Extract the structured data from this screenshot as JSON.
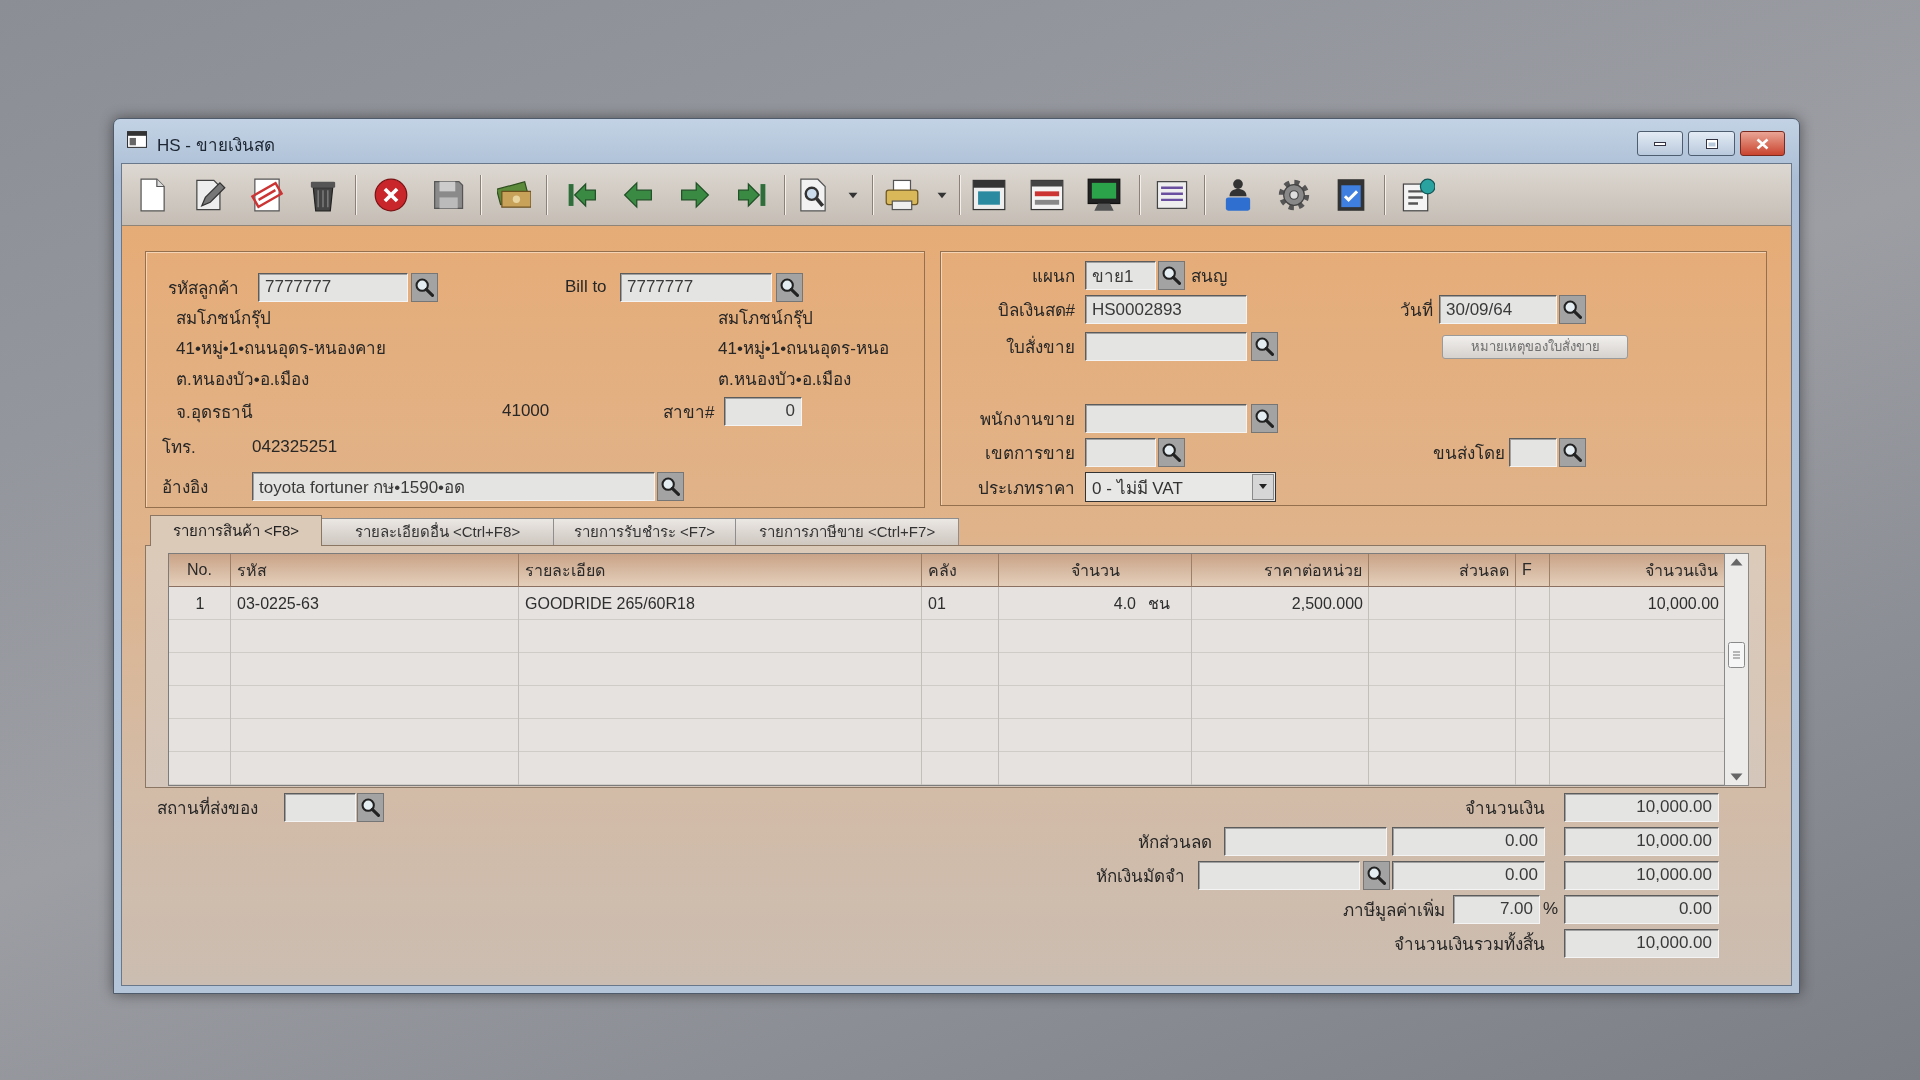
{
  "window": {
    "title": "HS - ขายเงินสด"
  },
  "customer": {
    "code_label": "รหัสลูกค้า",
    "code": "7777777",
    "name": "สมโภชน์กรุ๊ป",
    "address_lines": [
      "41•หมู่•1•ถนนอุดร-หนองคาย",
      "ต.หนองบัว•อ.เมือง",
      "จ.อุดรธานี"
    ],
    "postcode": "41000",
    "phone_label": "โทร.",
    "phone": "042325251",
    "reference_label": "อ้างอิง",
    "reference": "toyota fortuner กษ•1590•อด"
  },
  "bill_to": {
    "label": "Bill to",
    "code": "7777777",
    "name": "สมโภชน์กรุ๊ป",
    "address_lines": [
      "41•หมู่•1•ถนนอุดร-หนอ",
      "ต.หนองบัว•อ.เมือง"
    ],
    "branch_label": "สาขา#",
    "branch": "0"
  },
  "document": {
    "department_label": "แผนก",
    "department": "ขาย1",
    "department_name": "สนญ",
    "bill_number_label": "บิลเงินสด#",
    "bill_number": "HS0002893",
    "date_label": "วันที่",
    "date": "30/09/64",
    "sales_order_label": "ใบสั่งขาย",
    "remark_button": {
      "label": "หมายเหตุของใบสั่งขาย",
      "disabled": true
    },
    "salesperson_label": "พนักงานขาย",
    "sales_area_label": "เขตการขาย",
    "shipping_label": "ขนส่งโดย",
    "price_type_label": "ประเภทราคา",
    "price_type": "0 - ไม่มี VAT"
  },
  "tabs": [
    {
      "label": "รายการสินค้า <F8>",
      "selected": true
    },
    {
      "label": "รายละเอียดอื่น <Ctrl+F8>",
      "selected": false
    },
    {
      "label": "รายการรับชำระ <F7>",
      "selected": false
    },
    {
      "label": "รายการภาษีขาย <Ctrl+F7>",
      "selected": false
    }
  ],
  "table": {
    "columns": [
      "No.",
      "รหัส",
      "รายละเอียด",
      "คลัง",
      "จำนวน",
      "ราคาต่อหน่วย",
      "ส่วนลด",
      "F",
      "จำนวนเงิน"
    ],
    "rows": [
      {
        "no": "1",
        "code": "03-0225-63",
        "description": "GOODRIDE 265/60R18",
        "warehouse": "01",
        "quantity": "4.0",
        "unit": "ชน",
        "unit_price": "2,500.000",
        "amount": "10,000.00"
      }
    ]
  },
  "totals": {
    "delivery_place_label": "สถานที่ส่งของ",
    "amount_label": "จำนวนเงิน",
    "amount": "10,000.00",
    "discount_label": "หักส่วนลด",
    "discount": "0.00",
    "after_discount": "10,000.00",
    "deposit_label": "หักเงินมัดจำ",
    "deposit": "0.00",
    "after_deposit": "10,000.00",
    "vat_label": "ภาษีมูลค่าเพิ่ม",
    "vat_rate": "7.00",
    "vat_unit": "%",
    "vat": "0.00",
    "grand_total_label": "จำนวนเงินรวมทั้งสิ้น",
    "grand_total": "10,000.00"
  }
}
